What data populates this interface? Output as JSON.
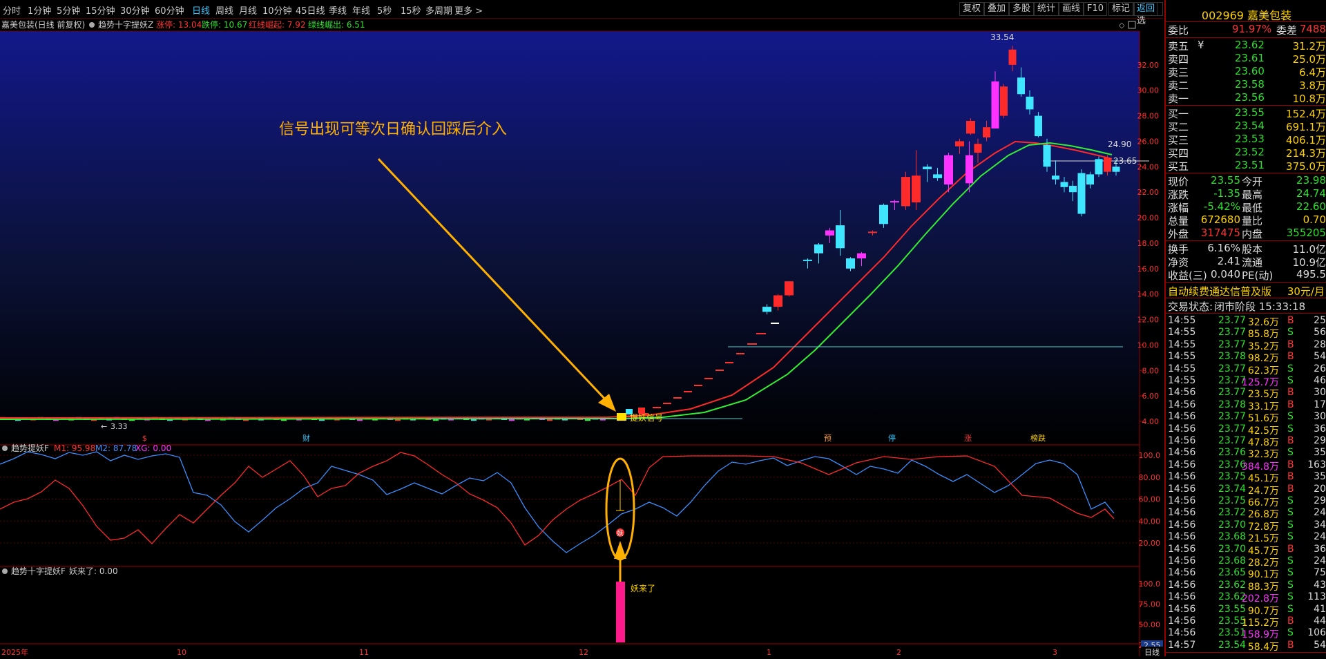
{
  "toolbar": {
    "periods": [
      "分时",
      "1分钟",
      "5分钟",
      "15分钟",
      "30分钟",
      "60分钟",
      "日线",
      "周线",
      "月线",
      "10分钟",
      "45日线",
      "季线",
      "年线",
      "5秒",
      "15秒",
      "多周期",
      "更多 >"
    ],
    "active_period": "日线",
    "right_buttons": [
      "复权",
      "叠加",
      "多股",
      "统计",
      "画线",
      "F10",
      "标记",
      "+自选",
      "返回"
    ],
    "active_right": "返回"
  },
  "main_chart": {
    "legend_name": "嘉美包装(日线 前复权)",
    "indicator_name": "趋势十字提妖Z",
    "values": [
      {
        "label": "涨停: 13.04",
        "color": "#ff3333"
      },
      {
        "label": "跌停: 10.67",
        "color": "#2ee02e"
      },
      {
        "label": "红线崛起: 7.92",
        "color": "#ff3333"
      },
      {
        "label": "绿线崛出: 6.51",
        "color": "#2ee02e"
      }
    ],
    "annotation": "信号出现可等次日确认回踩后介入",
    "signal_label": "提妖信号",
    "price_high_label": "33.54",
    "price_low_label": "3.33",
    "last_price_label": "24.90",
    "current_price_label": "23.65",
    "y_ticks": [
      "32.00",
      "30.00",
      "28.00",
      "26.00",
      "24.00",
      "22.00",
      "20.00",
      "18.00",
      "16.00",
      "14.00",
      "12.00",
      "10.00",
      "8.00",
      "6.00",
      "4.00"
    ],
    "event_markers": [
      {
        "label": "$",
        "color": "#ff3333"
      },
      {
        "label": "财",
        "color": "#3ac7ff"
      },
      {
        "label": "预",
        "color": "#ff9a33"
      },
      {
        "label": "停",
        "color": "#3ac7ff"
      },
      {
        "label": "涨",
        "color": "#ff3333"
      },
      {
        "label": "榜跌",
        "color": "#ffd200"
      }
    ]
  },
  "sub1": {
    "name": "趋势提妖F",
    "values": [
      {
        "label": "M1: 95.98",
        "color": "#ff3333"
      },
      {
        "label": "M2: 87.78",
        "color": "#3a8fff"
      },
      {
        "label": "XG: 0.00",
        "color": "#ff33ff"
      }
    ],
    "y_ticks": [
      "100.0",
      "80.00",
      "60.00",
      "40.00",
      "20.00"
    ],
    "badge": "妖"
  },
  "sub2": {
    "name": "趋势十字提妖F",
    "value_text": "妖来了: 0.00",
    "bar_label": "妖来了",
    "y_ticks": [
      "100.0",
      "75.00",
      "50.00",
      "25.00"
    ],
    "corner_value": "2.55"
  },
  "bottom_axis": {
    "labels": [
      "2025年",
      "10",
      "11",
      "12",
      "1",
      "2",
      "3"
    ],
    "corner_label": "日线"
  },
  "quote": {
    "code": "002969",
    "name": "嘉美包装",
    "weibi_label": "委比",
    "weibi": "91.97%",
    "weicha_label": "委差",
    "weicha": "7488",
    "asks": [
      {
        "label": "卖五",
        "note": "¥",
        "price": "23.62",
        "vol": "31.2万"
      },
      {
        "label": "卖四",
        "note": "",
        "price": "23.61",
        "vol": "25.0万"
      },
      {
        "label": "卖三",
        "note": "",
        "price": "23.60",
        "vol": "6.4万"
      },
      {
        "label": "卖二",
        "note": "",
        "price": "23.58",
        "vol": "3.8万"
      },
      {
        "label": "卖一",
        "note": "",
        "price": "23.56",
        "vol": "10.8万"
      }
    ],
    "bids": [
      {
        "label": "买一",
        "price": "23.55",
        "vol": "152.4万"
      },
      {
        "label": "买二",
        "price": "23.54",
        "vol": "691.1万"
      },
      {
        "label": "买三",
        "price": "23.53",
        "vol": "406.1万"
      },
      {
        "label": "买四",
        "price": "23.52",
        "vol": "214.3万"
      },
      {
        "label": "买五",
        "price": "23.51",
        "vol": "375.0万"
      }
    ],
    "stats": [
      {
        "l1": "现价",
        "v1": "23.55",
        "c1": "green",
        "l2": "今开",
        "v2": "23.98",
        "c2": "green"
      },
      {
        "l1": "涨跌",
        "v1": "-1.35",
        "c1": "green",
        "l2": "最高",
        "v2": "24.74",
        "c2": "green"
      },
      {
        "l1": "涨幅",
        "v1": "-5.42%",
        "c1": "green",
        "l2": "最低",
        "v2": "22.60",
        "c2": "green"
      },
      {
        "l1": "总量",
        "v1": "672680",
        "c1": "yellow",
        "l2": "量比",
        "v2": "0.70",
        "c2": "yellow"
      },
      {
        "l1": "外盘",
        "v1": "317475",
        "c1": "red",
        "l2": "内盘",
        "v2": "355205",
        "c2": "green"
      }
    ],
    "stats2": [
      {
        "l1": "换手",
        "v1": "6.16%",
        "l2": "股本",
        "v2": "11.0亿"
      },
      {
        "l1": "净资",
        "v1": "2.41",
        "l2": "流通",
        "v2": "10.9亿"
      },
      {
        "l1": "收益(三)",
        "v1": "0.040",
        "l2": "PE(动)",
        "v2": "495.5"
      }
    ],
    "promo": "自动续费通达信普及版",
    "promo_price": "30元/月",
    "trade_state_label": "交易状态:",
    "trade_state": "闭市阶段 15:33:18"
  },
  "ticks": [
    {
      "t": "14:55",
      "p": "23.77",
      "v": "32.6万",
      "s": "B",
      "n": "25"
    },
    {
      "t": "14:55",
      "p": "23.77",
      "v": "85.8万",
      "s": "S",
      "n": "56"
    },
    {
      "t": "14:55",
      "p": "23.77",
      "v": "35.2万",
      "s": "B",
      "n": "28"
    },
    {
      "t": "14:55",
      "p": "23.78",
      "v": "98.2万",
      "s": "B",
      "n": "54"
    },
    {
      "t": "14:55",
      "p": "23.77",
      "v": "62.3万",
      "s": "S",
      "n": "26"
    },
    {
      "t": "14:55",
      "p": "23.77",
      "v": "125.7万",
      "s": "S",
      "n": "46",
      "hl": true
    },
    {
      "t": "14:56",
      "p": "23.77",
      "v": "23.5万",
      "s": "B",
      "n": "30"
    },
    {
      "t": "14:56",
      "p": "23.78",
      "v": "33.1万",
      "s": "B",
      "n": "17"
    },
    {
      "t": "14:56",
      "p": "23.77",
      "v": "51.6万",
      "s": "S",
      "n": "30"
    },
    {
      "t": "14:56",
      "p": "23.77",
      "v": "42.5万",
      "s": "S",
      "n": "36"
    },
    {
      "t": "14:56",
      "p": "23.77",
      "v": "47.8万",
      "s": "B",
      "n": "29"
    },
    {
      "t": "14:56",
      "p": "23.76",
      "v": "32.3万",
      "s": "S",
      "n": "35"
    },
    {
      "t": "14:56",
      "p": "23.76",
      "v": "384.8万",
      "s": "B",
      "n": "163",
      "hl": true
    },
    {
      "t": "14:56",
      "p": "23.75",
      "v": "45.1万",
      "s": "B",
      "n": "35"
    },
    {
      "t": "14:56",
      "p": "23.74",
      "v": "24.7万",
      "s": "B",
      "n": "20"
    },
    {
      "t": "14:56",
      "p": "23.75",
      "v": "66.7万",
      "s": "S",
      "n": "29"
    },
    {
      "t": "14:56",
      "p": "23.72",
      "v": "26.8万",
      "s": "S",
      "n": "24"
    },
    {
      "t": "14:56",
      "p": "23.70",
      "v": "72.8万",
      "s": "S",
      "n": "34"
    },
    {
      "t": "14:56",
      "p": "23.68",
      "v": "21.5万",
      "s": "S",
      "n": "24"
    },
    {
      "t": "14:56",
      "p": "23.70",
      "v": "45.7万",
      "s": "B",
      "n": "36"
    },
    {
      "t": "14:56",
      "p": "23.68",
      "v": "28.2万",
      "s": "S",
      "n": "24"
    },
    {
      "t": "14:56",
      "p": "23.65",
      "v": "90.1万",
      "s": "S",
      "n": "75"
    },
    {
      "t": "14:56",
      "p": "23.62",
      "v": "88.3万",
      "s": "S",
      "n": "43"
    },
    {
      "t": "14:56",
      "p": "23.62",
      "v": "202.8万",
      "s": "S",
      "n": "113",
      "hl": true
    },
    {
      "t": "14:56",
      "p": "23.55",
      "v": "90.7万",
      "s": "S",
      "n": "41"
    },
    {
      "t": "14:56",
      "p": "23.55",
      "v": "115.2万",
      "s": "B",
      "n": "44"
    },
    {
      "t": "14:56",
      "p": "23.51",
      "v": "158.9万",
      "s": "S",
      "n": "106",
      "hl": true
    },
    {
      "t": "14:57",
      "p": "23.54",
      "v": "58.4万",
      "s": "B",
      "n": "54"
    }
  ],
  "chart_data": {
    "type": "candlestick",
    "ylim": [
      3,
      34
    ],
    "candles": [
      {
        "o": 24.0,
        "h": 24.6,
        "l": 23.3,
        "c": 23.6
      },
      {
        "o": 23.6,
        "h": 24.9,
        "l": 23.3,
        "c": 24.7
      },
      {
        "o": 24.6,
        "h": 24.8,
        "l": 23.2,
        "c": 23.4
      },
      {
        "o": 23.4,
        "h": 23.6,
        "l": 22.3,
        "c": 22.6
      },
      {
        "o": 23.5,
        "h": 23.8,
        "l": 20.1,
        "c": 20.3
      },
      {
        "o": 22.5,
        "h": 22.9,
        "l": 21.3,
        "c": 22.0
      },
      {
        "o": 22.8,
        "h": 23.2,
        "l": 22.0,
        "c": 22.4
      },
      {
        "o": 23.3,
        "h": 24.5,
        "l": 22.6,
        "c": 23.0
      },
      {
        "o": 25.7,
        "h": 26.2,
        "l": 23.6,
        "c": 24.0
      },
      {
        "o": 28.0,
        "h": 28.3,
        "l": 26.3,
        "c": 26.4
      },
      {
        "o": 29.5,
        "h": 30.0,
        "l": 28.1,
        "c": 28.5
      },
      {
        "o": 31.0,
        "h": 31.8,
        "l": 29.5,
        "c": 29.7
      },
      {
        "o": 32.0,
        "h": 33.5,
        "l": 31.5,
        "c": 33.2
      },
      {
        "o": 28.0,
        "h": 30.5,
        "l": 27.8,
        "c": 30.3
      },
      {
        "o": 27.0,
        "h": 31.5,
        "l": 27.0,
        "c": 30.7
      },
      {
        "o": 26.3,
        "h": 27.6,
        "l": 26.0,
        "c": 27.1
      },
      {
        "o": 25.1,
        "h": 26.2,
        "l": 24.3,
        "c": 25.8
      },
      {
        "o": 22.7,
        "h": 26.0,
        "l": 22.0,
        "c": 24.9
      }
    ]
  }
}
